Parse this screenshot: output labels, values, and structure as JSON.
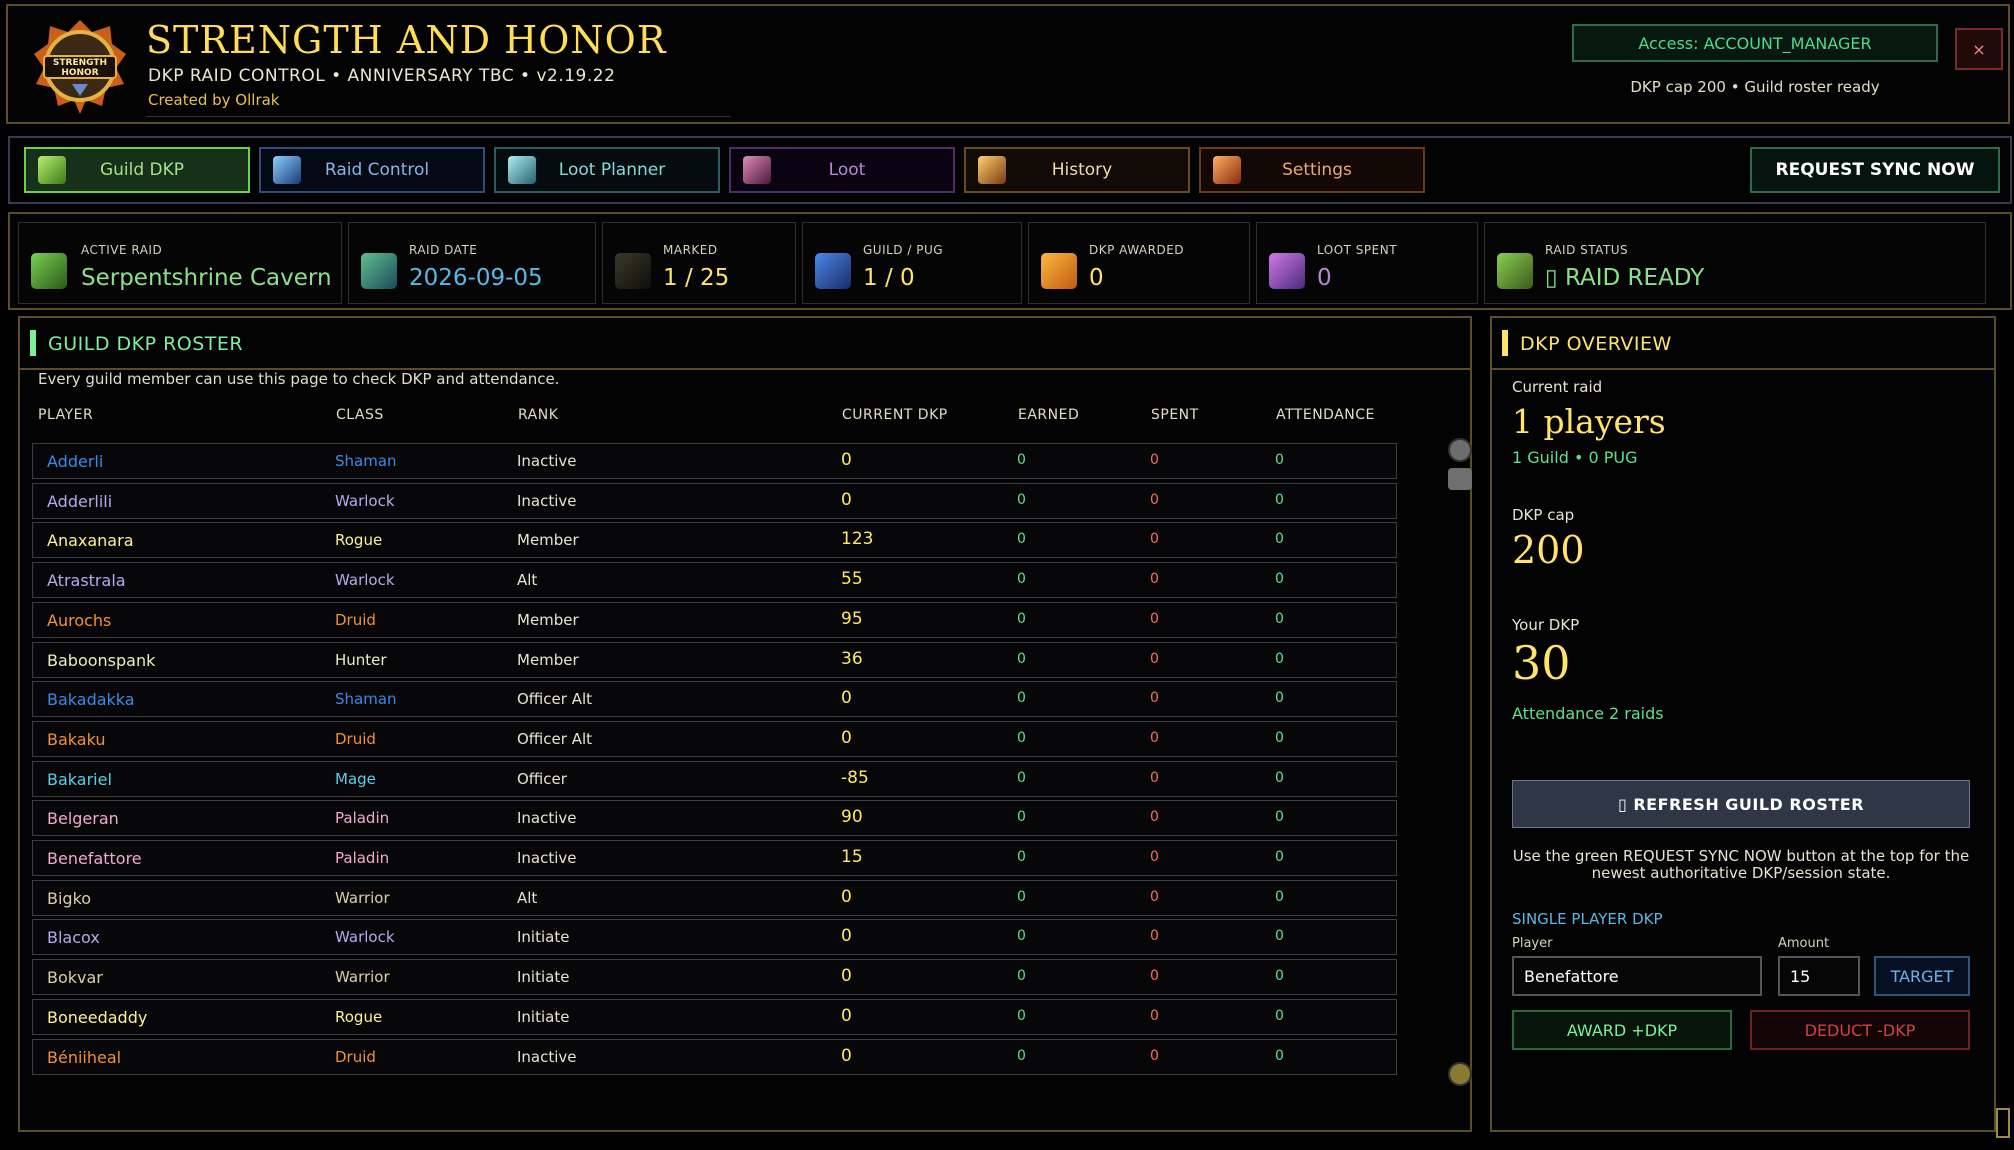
{
  "header": {
    "title": "STRENGTH AND HONOR",
    "subtitle": "DKP RAID CONTROL  •  ANNIVERSARY TBC  •  v2.19.22",
    "creator": "Created by Ollrak",
    "access": "Access: ACCOUNT_MANAGER",
    "close_label": "×",
    "cap_status": "DKP cap 200  •  Guild roster ready",
    "logo_text": "STRENGTH & HONOR"
  },
  "nav": {
    "tabs": [
      {
        "label": "Guild DKP",
        "icon": "potion-icon",
        "color": "#a7e08a",
        "border": "#6fd04a",
        "bg": "#16301a",
        "active": true
      },
      {
        "label": "Raid Control",
        "icon": "sword-icon",
        "color": "#8ab4e8",
        "border": "#2e4c78",
        "bg": "#040a14"
      },
      {
        "label": "Loot Planner",
        "icon": "scroll-icon",
        "color": "#8ad8d8",
        "border": "#2e5a60",
        "bg": "#040c10"
      },
      {
        "label": "Loot",
        "icon": "chest-icon",
        "color": "#b48ad8",
        "border": "#4c2e68",
        "bg": "#0a0412"
      },
      {
        "label": "History",
        "icon": "hourglass-icon",
        "color": "#f0dcaa",
        "border": "#6a4a20",
        "bg": "#120a04"
      },
      {
        "label": "Settings",
        "icon": "gear-icon",
        "color": "#f0a870",
        "border": "#6a3a20",
        "bg": "#120804"
      }
    ],
    "sync_label": "REQUEST SYNC NOW"
  },
  "stats": [
    {
      "label": "ACTIVE RAID",
      "value": "Serpentshrine Cavern",
      "color": "#8de08a",
      "icon": "raid-icon"
    },
    {
      "label": "RAID DATE",
      "value": "2026-09-05",
      "color": "#5ab8e8",
      "icon": "calendar-icon"
    },
    {
      "label": "MARKED",
      "value": "1 / 25",
      "color": "#ffe36a",
      "icon": "silhouette-icon"
    },
    {
      "label": "GUILD / PUG",
      "value": "1 / 0",
      "color": "#ffe36a",
      "icon": "guild-icon"
    },
    {
      "label": "DKP AWARDED",
      "value": "0",
      "color": "#ffe36a",
      "icon": "coins-icon"
    },
    {
      "label": "LOOT SPENT",
      "value": "0",
      "color": "#b48ad8",
      "icon": "orb-icon"
    },
    {
      "label": "RAID STATUS",
      "value": "▯ RAID READY",
      "color": "#8de08a",
      "icon": "status-icon"
    }
  ],
  "roster": {
    "title": "GUILD DKP ROSTER",
    "note": "Every guild member can use this page to check DKP and attendance.",
    "columns": [
      "PLAYER",
      "CLASS",
      "RANK",
      "CURRENT DKP",
      "EARNED",
      "SPENT",
      "ATTENDANCE"
    ],
    "rows": [
      {
        "name": "Adderli",
        "class": "Shaman",
        "rank": "Inactive",
        "dkp": "0",
        "earned": "0",
        "spent": "0",
        "att": "0",
        "color": "#3a8ae8"
      },
      {
        "name": "Adderlili",
        "class": "Warlock",
        "rank": "Inactive",
        "dkp": "0",
        "earned": "0",
        "spent": "0",
        "att": "0",
        "color": "#b8a8ee"
      },
      {
        "name": "Anaxanara",
        "class": "Rogue",
        "rank": "Member",
        "dkp": "123",
        "earned": "0",
        "spent": "0",
        "att": "0",
        "color": "#fff090"
      },
      {
        "name": "Atrastrala",
        "class": "Warlock",
        "rank": "Alt",
        "dkp": "55",
        "earned": "0",
        "spent": "0",
        "att": "0",
        "color": "#b8a8ee"
      },
      {
        "name": "Aurochs",
        "class": "Druid",
        "rank": "Member",
        "dkp": "95",
        "earned": "0",
        "spent": "0",
        "att": "0",
        "color": "#f49038"
      },
      {
        "name": "Baboonspank",
        "class": "Hunter",
        "rank": "Member",
        "dkp": "36",
        "earned": "0",
        "spent": "0",
        "att": "0",
        "color": "#e8f0c0"
      },
      {
        "name": "Bakadakka",
        "class": "Shaman",
        "rank": "Officer Alt",
        "dkp": "0",
        "earned": "0",
        "spent": "0",
        "att": "0",
        "color": "#3a8ae8"
      },
      {
        "name": "Bakaku",
        "class": "Druid",
        "rank": "Officer Alt",
        "dkp": "0",
        "earned": "0",
        "spent": "0",
        "att": "0",
        "color": "#f49038"
      },
      {
        "name": "Bakariel",
        "class": "Mage",
        "rank": "Officer",
        "dkp": "-85",
        "earned": "0",
        "spent": "0",
        "att": "0",
        "color": "#5ad0e8"
      },
      {
        "name": "Belgeran",
        "class": "Paladin",
        "rank": "Inactive",
        "dkp": "90",
        "earned": "0",
        "spent": "0",
        "att": "0",
        "color": "#f5a8d0"
      },
      {
        "name": "Benefattore",
        "class": "Paladin",
        "rank": "Inactive",
        "dkp": "15",
        "earned": "0",
        "spent": "0",
        "att": "0",
        "color": "#f5a8d0"
      },
      {
        "name": "Bigko",
        "class": "Warrior",
        "rank": "Alt",
        "dkp": "0",
        "earned": "0",
        "spent": "0",
        "att": "0",
        "color": "#e0cca8"
      },
      {
        "name": "Blacox",
        "class": "Warlock",
        "rank": "Initiate",
        "dkp": "0",
        "earned": "0",
        "spent": "0",
        "att": "0",
        "color": "#b8a8ee"
      },
      {
        "name": "Bokvar",
        "class": "Warrior",
        "rank": "Initiate",
        "dkp": "0",
        "earned": "0",
        "spent": "0",
        "att": "0",
        "color": "#e0cca8"
      },
      {
        "name": "Boneedaddy",
        "class": "Rogue",
        "rank": "Initiate",
        "dkp": "0",
        "earned": "0",
        "spent": "0",
        "att": "0",
        "color": "#fff090"
      },
      {
        "name": "Béniiheal",
        "class": "Druid",
        "rank": "Inactive",
        "dkp": "0",
        "earned": "0",
        "spent": "0",
        "att": "0",
        "color": "#f49038"
      }
    ]
  },
  "overview": {
    "title": "DKP OVERVIEW",
    "current_raid_label": "Current raid",
    "players": "1 players",
    "guild_pug": "1 Guild  •  0 PUG",
    "cap_label": "DKP cap",
    "cap_value": "200",
    "your_label": "Your DKP",
    "your_value": "30",
    "attendance": "Attendance  2 raids",
    "refresh_label": "▯  REFRESH GUILD ROSTER",
    "hint": "Use the green REQUEST SYNC NOW button at the top for the newest authoritative DKP/session state.",
    "single_title": "SINGLE PLAYER DKP",
    "player_label": "Player",
    "amount_label": "Amount",
    "player_value": "Benefattore",
    "amount_value": "15",
    "target_label": "TARGET",
    "award_label": "AWARD +DKP",
    "deduct_label": "DEDUCT -DKP"
  }
}
